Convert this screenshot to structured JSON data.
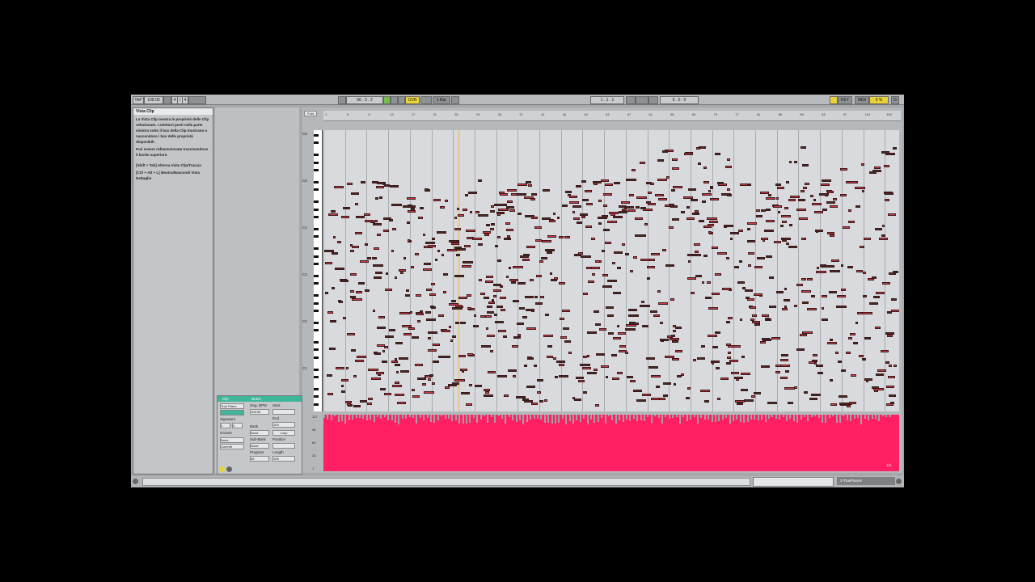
{
  "transport": {
    "tap": "TAP",
    "tempo": "108.00",
    "sig_num": "4",
    "sig_sep": "/",
    "sig_den": "4",
    "pos": "56 . 3 . 2",
    "ovr": "OVR",
    "quant": "1 Bar",
    "loop_start": "1 . 1 . 1",
    "loop_len": "6 . 0 . 0",
    "key": "KEY",
    "midi": "MIDI",
    "cpu": "9 %",
    "d": "D"
  },
  "info": {
    "title": "Vista Clip",
    "body1": "La Vista Clip mostra le proprietà delle Clip selezionate. I selettori posti nella parte sinistra sotto il box della Clip mostrano o nascondono i box delle proprietà disponibili.",
    "body2": "Può essere ridimensionata trascinandone il bordo superiore.",
    "body3": "[Shift + Tab] Alterna Vista Clip/Traccia",
    "body4": "[Ctrl + Alt + L] Mostra/Nascondi Vista Dettaglio"
  },
  "clip": {
    "header": "Clip",
    "name": "True Piano",
    "signature": "Signature",
    "sig_num": "4",
    "sig_den": "4",
    "groove": "Groove",
    "groove_val": "None",
    "commit": "Commit"
  },
  "notes_panel": {
    "header": "Notes",
    "orig_bpm": "Orig. BPM",
    "bpm": "108.00",
    "bank": "Bank",
    "bank_val": "None",
    "subbank": "Sub-Bank",
    "subbank_val": "None",
    "program": "Program",
    "program_val": "36",
    "start": "Start",
    "end": "End",
    "end_val": "109",
    "loop": "Loop",
    "position": "Position",
    "length": "Length",
    "length_val": "108"
  },
  "editor": {
    "fold": "Fold",
    "ruler": [
      "1",
      "5",
      "9",
      "13",
      "17",
      "21",
      "25",
      "29",
      "33",
      "37",
      "41",
      "45",
      "49",
      "53",
      "57",
      "61",
      "65",
      "69",
      "73",
      "77",
      "81",
      "85",
      "89",
      "93",
      "97",
      "101",
      "105"
    ],
    "octaves": [
      "C6",
      "C5",
      "C4",
      "C3",
      "C2",
      "C1"
    ],
    "velocity_ticks": [
      "127",
      "96",
      "64",
      "32",
      "1"
    ],
    "page": "1/1"
  },
  "statusbar": {
    "track": "2-TruePianos"
  },
  "colors": {
    "note": "#d93a45",
    "note_dark": "#4a2a28",
    "velocity": "#ff1f62",
    "playhead": "#e8c87a",
    "accent": "#3fb59a"
  }
}
